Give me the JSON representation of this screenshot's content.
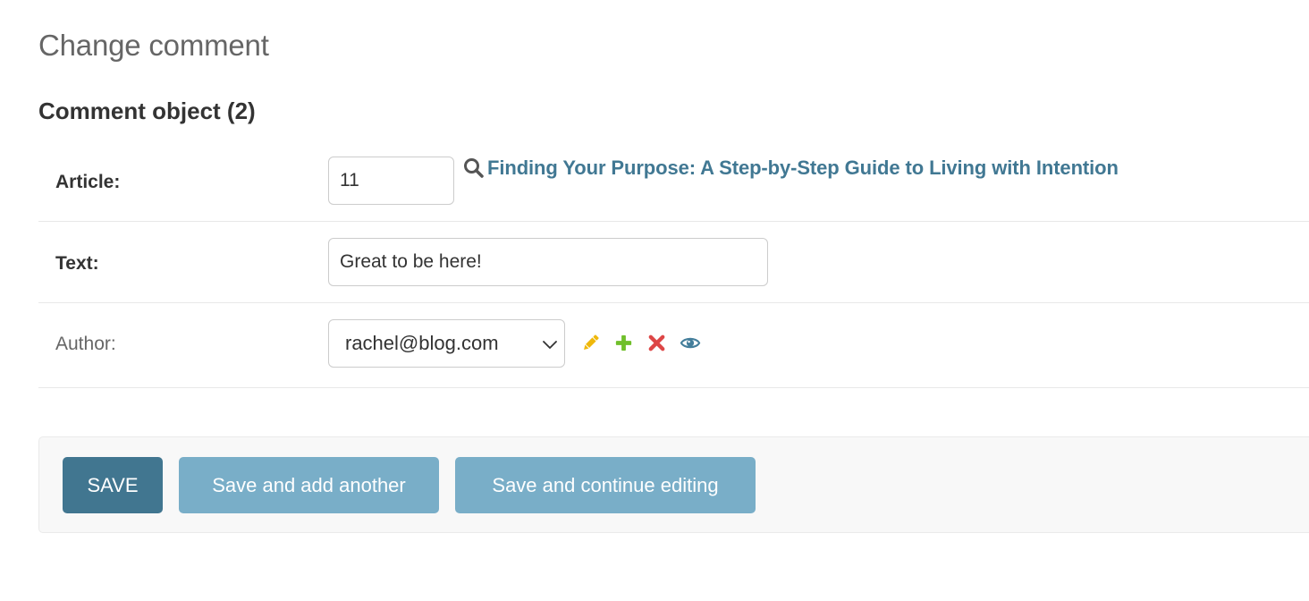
{
  "page": {
    "title": "Change comment",
    "fieldset_title": "Comment object (2)"
  },
  "form": {
    "article": {
      "label": "Article:",
      "value": "11",
      "lookup_icon": "search-icon",
      "related_link_text": "Finding Your Purpose: A Step-by-Step Guide to Living with Intention"
    },
    "text": {
      "label": "Text:",
      "value": "Great to be here!"
    },
    "author": {
      "label": "Author:",
      "selected": "rachel@blog.com",
      "actions": [
        {
          "icon": "pencil-icon",
          "name": "change-related",
          "color": "#efb80b"
        },
        {
          "icon": "plus-icon",
          "name": "add-related",
          "color": "#70bf2b"
        },
        {
          "icon": "x-icon",
          "name": "delete-related",
          "color": "#dd4646"
        },
        {
          "icon": "eye-icon",
          "name": "view-related",
          "color": "#447e9b"
        }
      ]
    }
  },
  "submit": {
    "save_label": "SAVE",
    "save_add_label": "Save and add another",
    "save_continue_label": "Save and continue editing"
  },
  "colors": {
    "primary_button": "#417690",
    "secondary_button": "#79aec8",
    "link": "#417893"
  }
}
